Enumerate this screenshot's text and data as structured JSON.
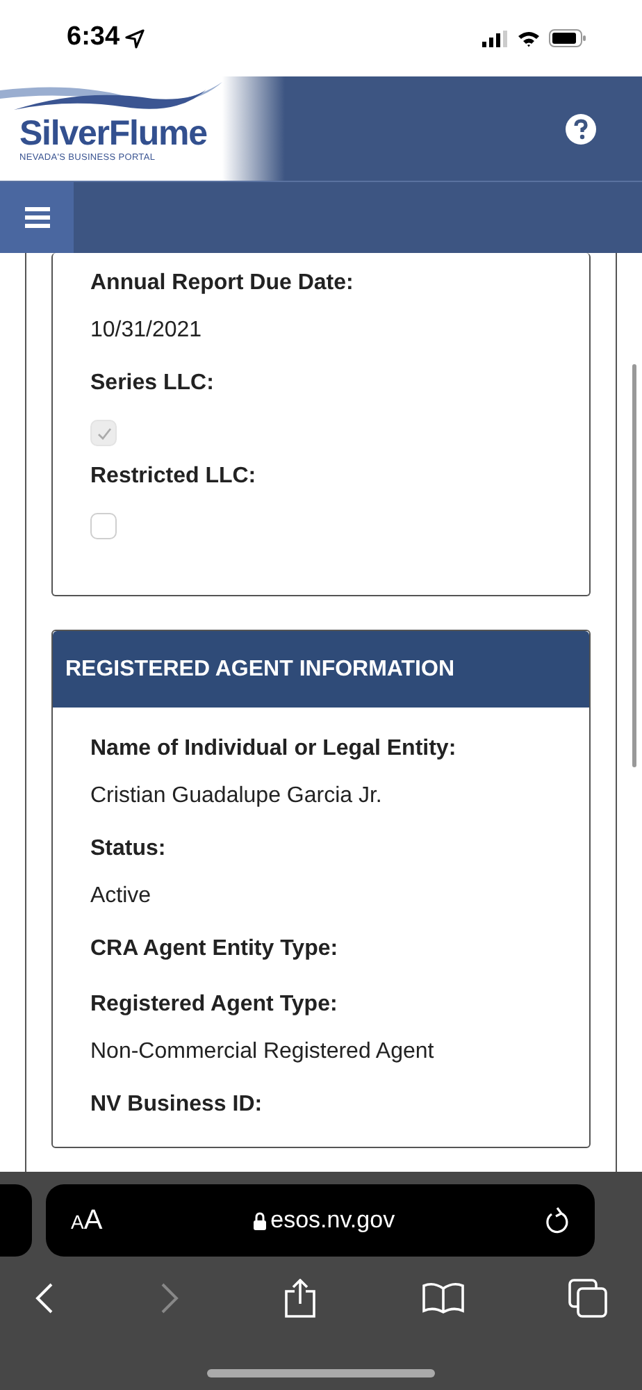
{
  "status_bar": {
    "time": "6:34"
  },
  "header": {
    "logo_title": "SilverFlume",
    "logo_subtitle": "NEVADA'S BUSINESS PORTAL"
  },
  "sections": [
    {
      "kind": "plain",
      "fields": [
        {
          "kind": "text",
          "label": "Annual Report Due Date:",
          "value": "10/31/2021"
        },
        {
          "kind": "checkbox",
          "label": "Series LLC:",
          "checked": true
        },
        {
          "kind": "checkbox",
          "label": "Restricted LLC:",
          "checked": false
        }
      ]
    },
    {
      "kind": "titled",
      "title": "REGISTERED AGENT INFORMATION",
      "fields": [
        {
          "kind": "text",
          "label": "Name of Individual or Legal Entity:",
          "value": "Cristian Guadalupe Garcia Jr."
        },
        {
          "kind": "text",
          "label": "Status:",
          "value": "Active"
        },
        {
          "kind": "text",
          "label": "CRA Agent Entity Type:"
        },
        {
          "kind": "text",
          "label": "Registered Agent Type:",
          "value": "Non-Commercial Registered Agent"
        },
        {
          "kind": "text",
          "label": "NV Business ID:"
        }
      ]
    }
  ],
  "browser": {
    "text_size": "AA",
    "url": "esos.nv.gov"
  }
}
